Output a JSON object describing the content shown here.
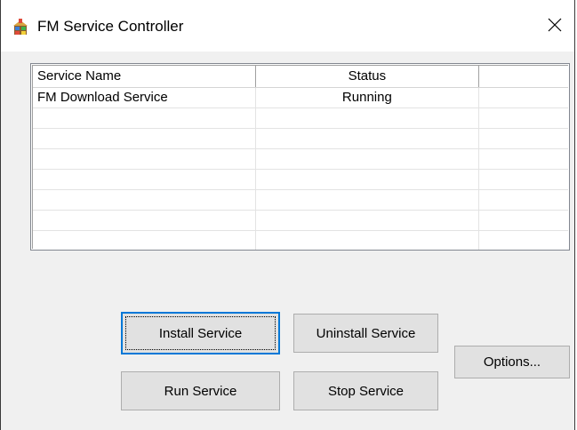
{
  "window": {
    "title": "FM Service Controller",
    "app_icon": "fm-app-icon",
    "close_icon": "close-icon"
  },
  "list": {
    "columns": [
      "Service Name",
      "Status",
      ""
    ],
    "rows": [
      [
        "FM Download Service",
        "Running",
        ""
      ],
      [
        "",
        "",
        ""
      ],
      [
        "",
        "",
        ""
      ],
      [
        "",
        "",
        ""
      ],
      [
        "",
        "",
        ""
      ],
      [
        "",
        "",
        ""
      ],
      [
        "",
        "",
        ""
      ],
      [
        "",
        "",
        ""
      ]
    ]
  },
  "buttons": {
    "install": "Install Service",
    "uninstall": "Uninstall Service",
    "run": "Run Service",
    "stop": "Stop Service",
    "options": "Options..."
  },
  "colors": {
    "focus_border": "#0078d7",
    "button_face": "#e1e1e1",
    "window_bg": "#f0f0f0"
  }
}
